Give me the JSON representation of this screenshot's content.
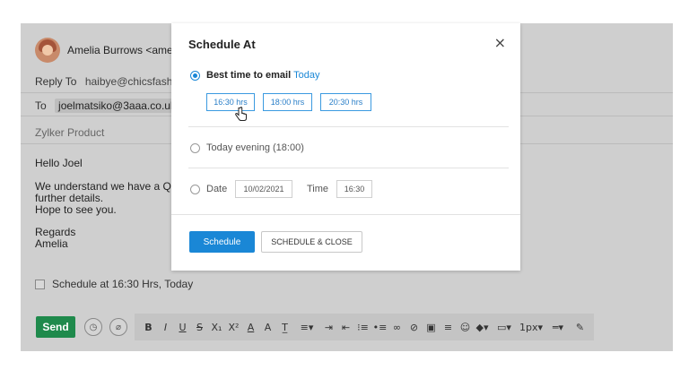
{
  "composer": {
    "from_name": "Amelia Burrows <amelia",
    "reply_to_label": "Reply To",
    "reply_to_value": "haibye@chicsfashion.c",
    "to_label": "To",
    "to_chip": "joelmatsiko@3aaa.co.uk",
    "to_chip_remove": "×",
    "subject": "Zylker Product",
    "body": {
      "greeting": "Hello Joel",
      "line1": "We understand we have a Quick",
      "line2": "further details.",
      "line3": "Hope to see you.",
      "regards": "Regards",
      "signature": "Amelia"
    },
    "schedule_checkbox_label": "Schedule at 16:30 Hrs, Today",
    "send_label": "Send"
  },
  "toolbar": {
    "icons": [
      "clock-icon",
      "attachment-icon",
      "bold-icon",
      "italic-icon",
      "underline-icon",
      "strikethrough-icon",
      "subscript-icon",
      "superscript-icon",
      "font-color-icon",
      "highlight-icon",
      "clear-format-icon",
      "align-icon",
      "indent-icon",
      "outdent-icon",
      "numbered-list-icon",
      "bullet-list-icon",
      "link-icon",
      "unlink-icon",
      "image-icon",
      "horizontal-rule-icon",
      "emoji-icon",
      "fill-icon",
      "border-icon",
      "line-width-icon",
      "line-style-icon",
      "signature-icon"
    ],
    "glyphs": {
      "bold": "B",
      "italic": "I",
      "underline": "U",
      "strike": "S",
      "sub": "X₁",
      "sup": "X²",
      "font_color": "A",
      "highlight": "A",
      "clear": "T̲",
      "align": "≡▾",
      "indent": "⇥",
      "outdent": "⇤",
      "numbered": "⁝≡",
      "bullets": "•≡",
      "link": "🔗",
      "unlink": "⊘",
      "image": "▣",
      "hr": "≡",
      "emoji": "☺",
      "fill": "◆▾",
      "border": "▭▾",
      "line_width": "1px▾",
      "line_style": "═▾",
      "sign": "✎"
    }
  },
  "dialog": {
    "title": "Schedule At",
    "close": "×",
    "best_time_label": "Best time to email",
    "best_time_today": "Today",
    "slots": [
      "16:30 hrs",
      "18:00 hrs",
      "20:30 hrs"
    ],
    "evening_label": "Today evening (18:00)",
    "date_label": "Date",
    "date_value": "10/02/2021",
    "time_label": "Time",
    "time_value": "16:30",
    "schedule_button": "Schedule",
    "schedule_close_button": "SCHEDULE & CLOSE"
  },
  "colors": {
    "accent": "#1a87d6",
    "send_green": "#1f8a4c",
    "overlay_gray": "#cfcfcf"
  }
}
